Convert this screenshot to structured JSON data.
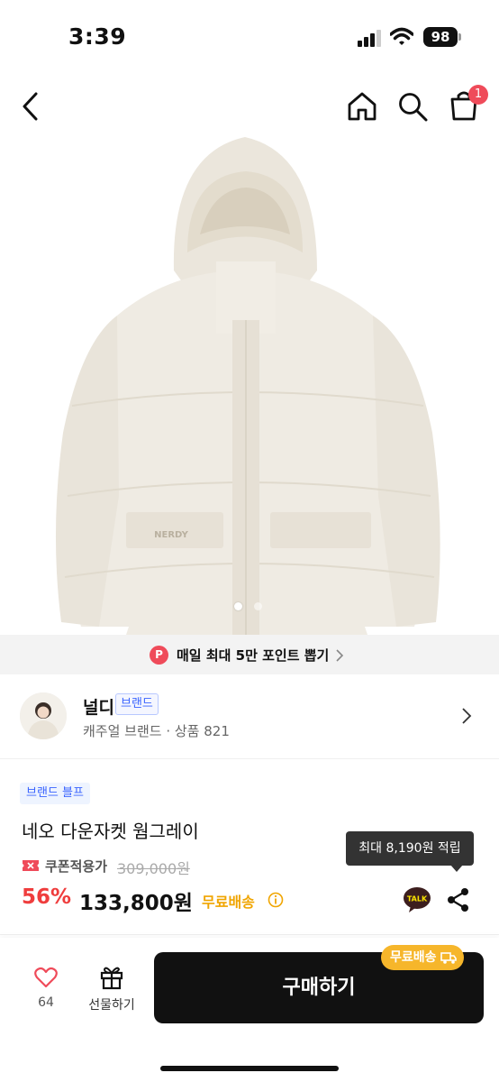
{
  "status_bar": {
    "time": "3:39",
    "battery": "98"
  },
  "nav": {
    "cart_count": "1"
  },
  "carousel": {
    "total_dots": 2,
    "active_index": 0
  },
  "points_banner": {
    "badge": "P",
    "text": "매일 최대 5만 포인트 뽑기"
  },
  "brand": {
    "name": "널디",
    "tag": "브랜드",
    "description": "캐주얼 브랜드 · 상품 821"
  },
  "product": {
    "store_badge": "브랜드 블프",
    "title": "네오 다운자켓 웜그레이",
    "coupon_label": "쿠폰적용가",
    "original_price": "309,000원",
    "discount": "56%",
    "price": "133,800원",
    "free_shipping": "무료배송",
    "jacket_logo": "NERDY"
  },
  "tooltip": {
    "text": "최대 8,190원 적립"
  },
  "icons": {
    "talk": "TALK"
  },
  "bottom_bar": {
    "like_count": "64",
    "gift_label": "선물하기",
    "buy_label": "구매하기",
    "ship_chip": "무료배송"
  },
  "colors": {
    "accent_red": "#ef3d3d",
    "badge_red": "#ef4b5a",
    "brand_blue": "#3a64ff",
    "shipping_yellow": "#f0a500",
    "chip_yellow": "#f6b62b",
    "buy_button": "#111111"
  }
}
